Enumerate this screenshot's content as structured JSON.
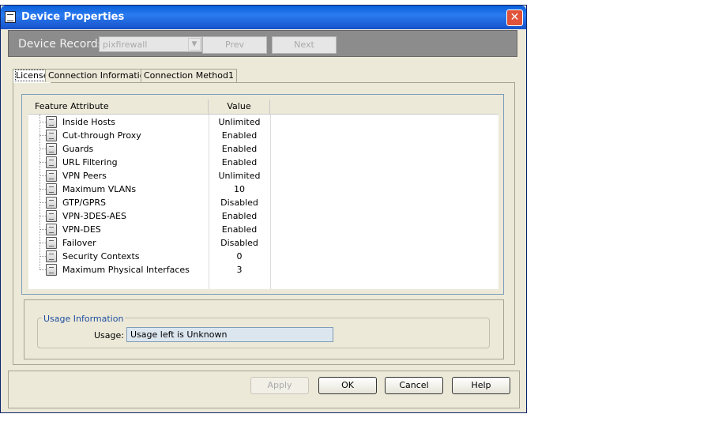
{
  "window": {
    "title": "Device Properties",
    "close_glyph": "✕"
  },
  "records": {
    "label": "Device Records",
    "selected": "pixfirewall",
    "prev_label": "Prev",
    "next_label": "Next"
  },
  "tabs": [
    {
      "label": "License"
    },
    {
      "label": "Connection Information"
    },
    {
      "label": "Connection Method1"
    }
  ],
  "table": {
    "headers": {
      "feature": "Feature Attribute",
      "value": "Value"
    },
    "rows": [
      {
        "name": "Inside Hosts",
        "value": "Unlimited"
      },
      {
        "name": "Cut-through Proxy",
        "value": "Enabled"
      },
      {
        "name": "Guards",
        "value": "Enabled"
      },
      {
        "name": "URL Filtering",
        "value": "Enabled"
      },
      {
        "name": "VPN Peers",
        "value": "Unlimited"
      },
      {
        "name": "Maximum VLANs",
        "value": "10"
      },
      {
        "name": "GTP/GPRS",
        "value": "Disabled"
      },
      {
        "name": "VPN-3DES-AES",
        "value": "Enabled"
      },
      {
        "name": "VPN-DES",
        "value": "Enabled"
      },
      {
        "name": "Failover",
        "value": "Disabled"
      },
      {
        "name": "Security Contexts",
        "value": "0"
      },
      {
        "name": "Maximum Physical Interfaces",
        "value": "3"
      }
    ]
  },
  "usage": {
    "group_title": "Usage Information",
    "label": "Usage:",
    "value": "Usage left is Unknown"
  },
  "buttons": {
    "apply": "Apply",
    "ok": "OK",
    "cancel": "Cancel",
    "help": "Help"
  }
}
